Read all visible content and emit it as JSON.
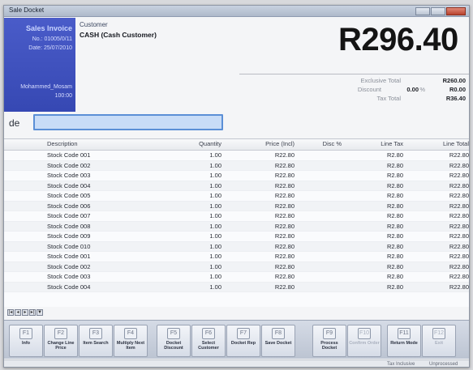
{
  "window": {
    "title": "Sale Docket"
  },
  "left_panel": {
    "doc_type": "Sales Invoice",
    "number": "No.: 01005/0/11",
    "date": "Date: 25/07/2010",
    "user": "Mohammed_Mosam",
    "till": "100:00"
  },
  "customer": {
    "label": "Customer",
    "name": "CASH (Cash Customer)"
  },
  "total": "R296.40",
  "summary": {
    "exclusive_label": "Exclusive Total",
    "exclusive_value": "R260.00",
    "discount_label": "Discount",
    "discount_pct": "0.00",
    "discount_pct_sign": "%",
    "discount_value": "R0.00",
    "tax_label": "Tax Total",
    "tax_value": "R36.40"
  },
  "code_entry": {
    "label": "de",
    "value": ""
  },
  "grid": {
    "headers": [
      "Description",
      "Quantity",
      "Price (Incl)",
      "Disc %",
      "Line Tax",
      "Line Total"
    ],
    "rows": [
      {
        "desc": "Stock Code 001",
        "qty": "1.00",
        "price": "R22.80",
        "disc": "",
        "tax": "R2.80",
        "total": "R22.80"
      },
      {
        "desc": "Stock Code 002",
        "qty": "1.00",
        "price": "R22.80",
        "disc": "",
        "tax": "R2.80",
        "total": "R22.80"
      },
      {
        "desc": "Stock Code 003",
        "qty": "1.00",
        "price": "R22.80",
        "disc": "",
        "tax": "R2.80",
        "total": "R22.80"
      },
      {
        "desc": "Stock Code 004",
        "qty": "1.00",
        "price": "R22.80",
        "disc": "",
        "tax": "R2.80",
        "total": "R22.80"
      },
      {
        "desc": "Stock Code 005",
        "qty": "1.00",
        "price": "R22.80",
        "disc": "",
        "tax": "R2.80",
        "total": "R22.80"
      },
      {
        "desc": "Stock Code 006",
        "qty": "1.00",
        "price": "R22.80",
        "disc": "",
        "tax": "R2.80",
        "total": "R22.80"
      },
      {
        "desc": "Stock Code 007",
        "qty": "1.00",
        "price": "R22.80",
        "disc": "",
        "tax": "R2.80",
        "total": "R22.80"
      },
      {
        "desc": "Stock Code 008",
        "qty": "1.00",
        "price": "R22.80",
        "disc": "",
        "tax": "R2.80",
        "total": "R22.80"
      },
      {
        "desc": "Stock Code 009",
        "qty": "1.00",
        "price": "R22.80",
        "disc": "",
        "tax": "R2.80",
        "total": "R22.80"
      },
      {
        "desc": "Stock Code 010",
        "qty": "1.00",
        "price": "R22.80",
        "disc": "",
        "tax": "R2.80",
        "total": "R22.80"
      },
      {
        "desc": "Stock Code 001",
        "qty": "1.00",
        "price": "R22.80",
        "disc": "",
        "tax": "R2.80",
        "total": "R22.80"
      },
      {
        "desc": "Stock Code 002",
        "qty": "1.00",
        "price": "R22.80",
        "disc": "",
        "tax": "R2.80",
        "total": "R22.80"
      },
      {
        "desc": "Stock Code 003",
        "qty": "1.00",
        "price": "R22.80",
        "disc": "",
        "tax": "R2.80",
        "total": "R22.80"
      },
      {
        "desc": "Stock Code 004",
        "qty": "1.00",
        "price": "R22.80",
        "disc": "",
        "tax": "R2.80",
        "total": "R22.80"
      }
    ]
  },
  "function_keys": [
    {
      "key": "F1",
      "label": "Info",
      "enabled": true
    },
    {
      "key": "F2",
      "label": "Change Line Price",
      "enabled": true
    },
    {
      "key": "F3",
      "label": "Item Search",
      "enabled": true
    },
    {
      "key": "F4",
      "label": "Multiply Next Item",
      "enabled": true
    },
    {
      "key": "F5",
      "label": "Docket Discount",
      "enabled": true
    },
    {
      "key": "F6",
      "label": "Select Customer",
      "enabled": true
    },
    {
      "key": "F7",
      "label": "Docket Rep",
      "enabled": true
    },
    {
      "key": "F8",
      "label": "Save Docket",
      "enabled": true
    },
    {
      "key": "F9",
      "label": "Process Docket",
      "enabled": true
    },
    {
      "key": "F10",
      "label": "Confirm Order",
      "enabled": false
    },
    {
      "key": "F11",
      "label": "Return Mode",
      "enabled": true
    },
    {
      "key": "F12",
      "label": "Exit",
      "enabled": false
    }
  ],
  "status": {
    "tax_mode": "Tax Inclusive",
    "state": "Unprocessed"
  }
}
